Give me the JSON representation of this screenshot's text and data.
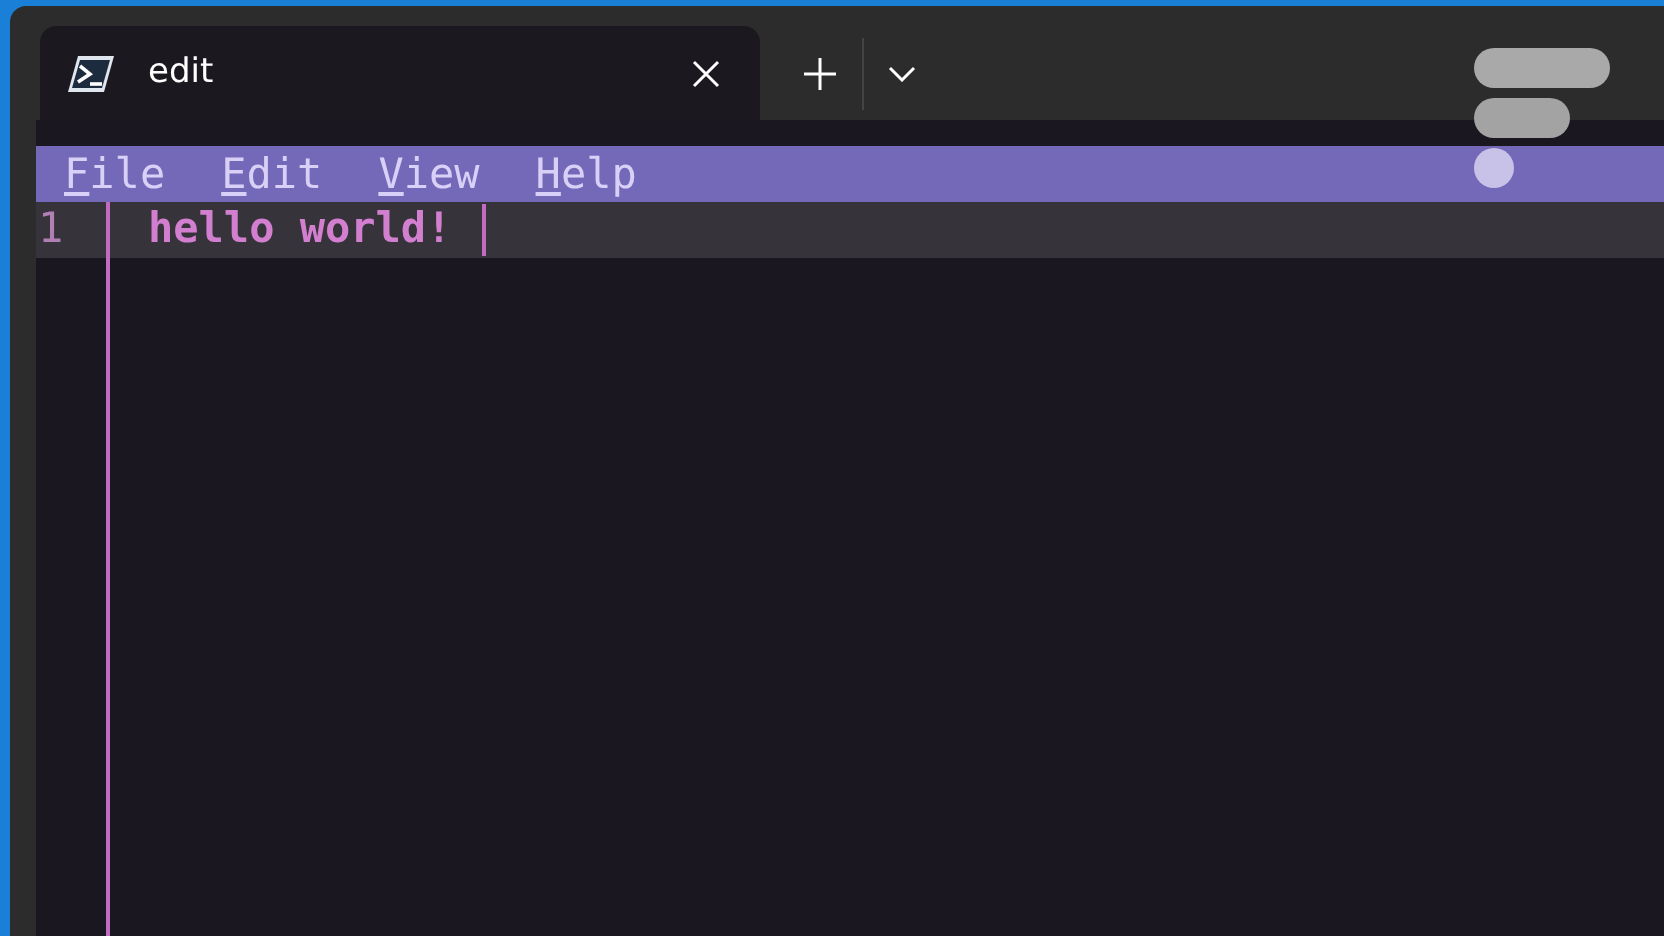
{
  "window": {
    "tabs": [
      {
        "title": "edit",
        "selected": true
      }
    ]
  },
  "menu": [
    {
      "label": "File"
    },
    {
      "label": "Edit"
    },
    {
      "label": "View"
    },
    {
      "label": "Help"
    }
  ],
  "editor": {
    "lines": [
      {
        "number": "1",
        "text": "hello world!",
        "current": true
      }
    ]
  }
}
